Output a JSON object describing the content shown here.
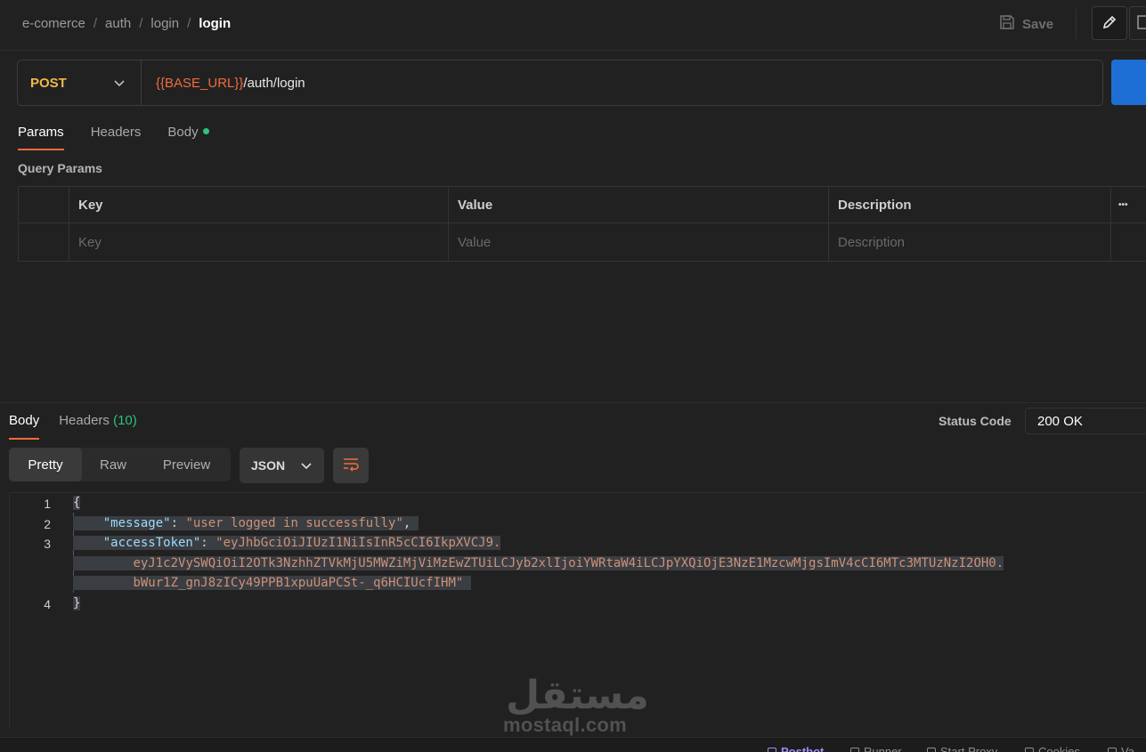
{
  "breadcrumb": {
    "items": [
      "e-comerce",
      "auth",
      "login"
    ],
    "current": "login"
  },
  "toolbar": {
    "save_label": "Save"
  },
  "request": {
    "method": "POST",
    "url_var": "{{BASE_URL}}",
    "url_path": "/auth/login"
  },
  "request_tabs": {
    "params": "Params",
    "headers": "Headers",
    "body": "Body"
  },
  "query_params": {
    "title": "Query Params",
    "headers": {
      "key": "Key",
      "value": "Value",
      "description": "Description",
      "more": "•••"
    },
    "placeholders": {
      "key": "Key",
      "value": "Value",
      "description": "Description"
    }
  },
  "response_tabs": {
    "body": "Body",
    "headers": "Headers",
    "headers_count": "(10)"
  },
  "status": {
    "label": "Status Code",
    "value": "200 OK"
  },
  "view_modes": {
    "pretty": "Pretty",
    "raw": "Raw",
    "preview": "Preview"
  },
  "format": {
    "selected": "JSON"
  },
  "response_body": {
    "line_numbers": [
      "1",
      "2",
      "3",
      "4"
    ],
    "open_brace": "{",
    "close_brace": "}",
    "message_key": "\"message\"",
    "message_value": "\"user logged in successfully\"",
    "token_key": "\"accessToken\"",
    "token_line1": "\"eyJhbGciOiJIUzI1NiIsInR5cCI6IkpXVCJ9.",
    "token_line2": "eyJ1c2VySWQiOiI2OTk3NzhhZTVkMjU5MWZiMjViMzEwZTUiLCJyb2xlIjoiYWRtaW4iLCJpYXQiOjE3NzE1MzcwMjgsImV4cCI6MTc3MTUzNzI2OH0.",
    "token_line3": "bWur1Z_gnJ8zICy49PPB1xpuUaPCSt-_q6HCIUcfIHM\""
  },
  "watermark": {
    "arabic": "مستقل",
    "latin": "mostaql.com"
  },
  "statusbar": {
    "items": [
      "Postbot",
      "Runner",
      "Start Proxy",
      "Cookies",
      "Va"
    ]
  },
  "colors": {
    "accent": "#ef6c3c",
    "method": "#f2b84a",
    "success": "#2ec27e",
    "send": "#1d6fd6"
  }
}
